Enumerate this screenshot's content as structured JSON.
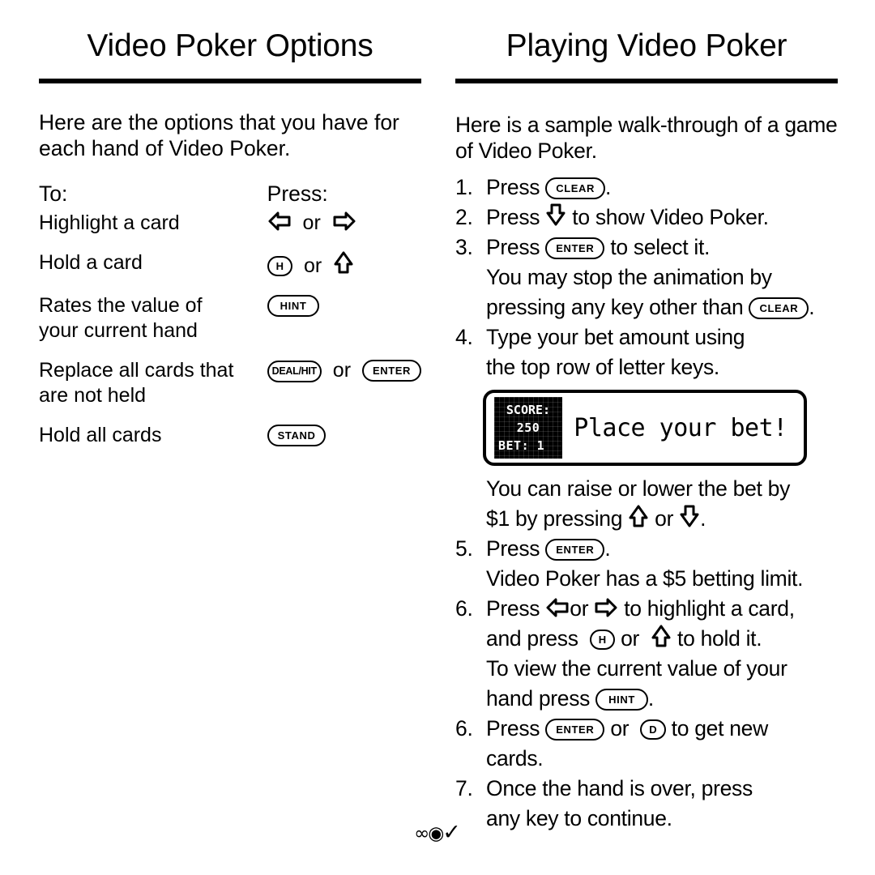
{
  "left": {
    "title": "Video Poker Options",
    "intro": "Here are the options that you have for each hand of Video Poker.",
    "table": {
      "header": {
        "col1": "To:",
        "col2": "Press:"
      },
      "rows": [
        {
          "action": "Highlight a card",
          "keys": "left-arrow or right-arrow"
        },
        {
          "action": "Hold a card",
          "keys": "H key or up-arrow"
        },
        {
          "action": "Rates the value of your current hand",
          "keys": "HINT key"
        },
        {
          "action": "Replace all cards that are not held",
          "keys": "DEAL/HIT key or ENTER key"
        },
        {
          "action": "Hold all cards",
          "keys": "STAND key"
        }
      ],
      "row_lines": {
        "r3a": "Rates the value of",
        "r3b": "your current hand",
        "r4a": "Replace all cards that",
        "r4b": "are not held",
        "r1": "Highlight a card",
        "r2": "Hold a card",
        "r5": "Hold all cards"
      }
    }
  },
  "right": {
    "title": "Playing Video Poker",
    "intro_line1": "Here is a sample walk-through of a game",
    "intro_line2": "of Video Poker.",
    "steps": [
      {
        "num": "1.",
        "pre": "Press",
        "key": "CLEAR",
        "post": "."
      },
      {
        "num": "2.",
        "pre": "Press",
        "icon": "down-arrow",
        "post": "to show Video Poker."
      },
      {
        "num": "3.",
        "pre": "Press",
        "key": "ENTER",
        "post": "to select it."
      },
      {
        "sub_line1": "You may stop the animation by",
        "sub_line2_pre": "pressing any key other than",
        "sub_key": "CLEAR",
        "sub_line2_post": "."
      },
      {
        "num": "4.",
        "line1": "Type your bet amount using",
        "line2": "the top row of letter keys."
      },
      {
        "sub_line1": "You can raise or lower the bet by",
        "sub_line2_pre": "$1 by pressing",
        "icon_a": "up-arrow",
        "mid": "or",
        "icon_b": "down-arrow",
        "sub_line2_post": "."
      },
      {
        "num": "5.",
        "pre": "Press",
        "key": "ENTER",
        "post": "."
      },
      {
        "sub_line1": "Video Poker has a $5 betting limit."
      },
      {
        "num": "6.",
        "l1_pre": "Press",
        "l1_icon_a": "left-arrow",
        "l1_mid": "or",
        "l1_icon_b": "right-arrow",
        "l1_post": "to highlight a card,",
        "l2_pre": "and press",
        "l2_key": "H",
        "l2_mid": "or",
        "l2_icon": "up-arrow",
        "l2_post": "to hold it."
      },
      {
        "sub_line1": "To view the current value of your",
        "sub_line2_pre": "hand press",
        "sub_key": "HINT",
        "sub_line2_post": "."
      },
      {
        "num": "6.",
        "pre": "Press",
        "key_a": "ENTER",
        "mid": "or",
        "key_b": "D",
        "post": "to get new",
        "line2": "cards."
      },
      {
        "num": "7.",
        "line1": "Once the hand is over, press",
        "line2": "any key to continue."
      }
    ],
    "lcd": {
      "score_label": "SCORE:",
      "score_value": "250",
      "bet_line": "BET: 1",
      "message": "Place your bet!"
    }
  },
  "footer": {
    "glyph": "∞◉",
    "check": "✓"
  }
}
